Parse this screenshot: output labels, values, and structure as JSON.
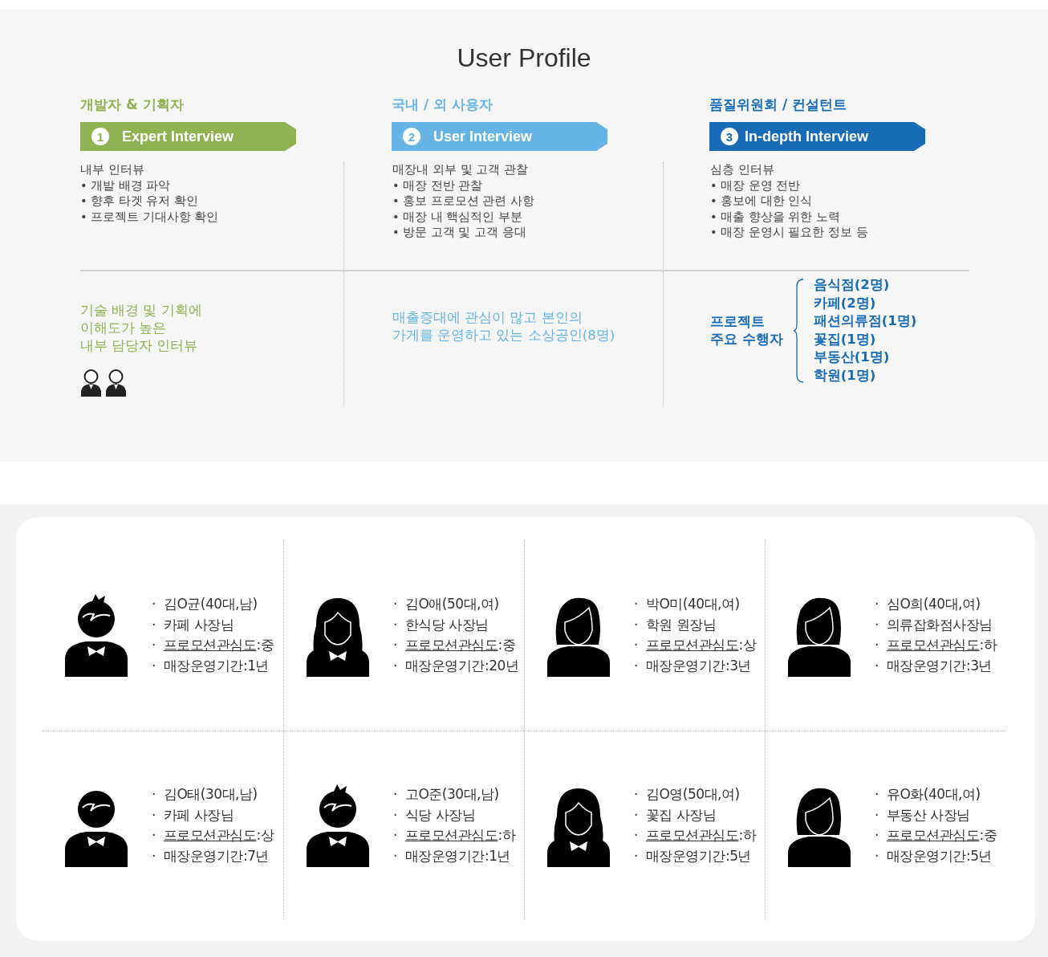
{
  "title": "User Profile",
  "groups": [
    {
      "kind": "people",
      "heading": "개발자 & 기획자",
      "color": "#8fb253",
      "badge": "1",
      "banner": "Expert Interview",
      "lead": "내부 인터뷰",
      "items": [
        "• 개발 배경 파악",
        "• 향후 타겟 유저 확인",
        "• 프로젝트 기대사항 확인"
      ],
      "summary": [
        "기술 배경 및 기획에",
        "이해도가 높은",
        "내부 담당자 인터뷰"
      ]
    },
    {
      "kind": "text",
      "heading": "국내 / 외 사용자",
      "color": "#66b4e6",
      "badge": "2",
      "banner": "User Interview",
      "lead": "매장내 외부 및 고객 관찰",
      "items": [
        "• 매장 전반 관찰",
        "• 홍보 프로모션  관련 사항",
        "• 매장 내 핵심적인 부분",
        "• 방문 고객 및 고객 응대"
      ],
      "summary": [
        "매출증대에 관심이 많고 본인의",
        "가게를 운영하고 있는 소상공인(8명)"
      ]
    },
    {
      "kind": "breakdown",
      "heading": "품질위원회 / 컨설턴트",
      "color": "#176bb7",
      "badge": "3",
      "banner": "In-depth Interview",
      "lead": "심층 인터뷰",
      "items": [
        "• 매장 운영 전반",
        "• 홍보에 대한 인식",
        "• 매출 향상을 위한 노력",
        "• 매장 운영시 필요한 정보 등"
      ],
      "summary": [
        "프로젝트",
        "주요 수행자"
      ],
      "breakdown": [
        "음식점(2명)",
        "카페(2명)",
        "패션의류점(1명)",
        "꽃집(1명)",
        "부동산(1명)",
        "학원(1명)"
      ]
    }
  ],
  "personas": [
    {
      "kind": "spiky-man",
      "lines": [
        "김O균(40대,남)",
        "카페 사장님",
        "프로모션관심도:중",
        "매장운영기간:1년"
      ]
    },
    {
      "kind": "long-hair-woman",
      "lines": [
        "김O애(50대,여)",
        "한식당 사장님",
        "프로모션관심도:중",
        "매장운영기간:20년"
      ]
    },
    {
      "kind": "woman",
      "lines": [
        "박O미(40대,여)",
        "학원 원장님",
        "프로모션관심도:상",
        "매장운영기간:3년"
      ]
    },
    {
      "kind": "woman",
      "lines": [
        "심O희(40대,여)",
        "의류잡화점사장님",
        "프로모션관심도:하",
        "매장운영기간:3년"
      ]
    },
    {
      "kind": "man",
      "lines": [
        "김O태(30대,남)",
        "카페 사장님",
        "프로모션관심도:상",
        "매장운영기간:7년"
      ]
    },
    {
      "kind": "spiky-man",
      "lines": [
        "고O준(30대,남)",
        "식당 사장님",
        "프로모션관심도:하",
        "매장운영기간:1년"
      ]
    },
    {
      "kind": "long-hair-woman",
      "lines": [
        "김O영(50대,여)",
        "꽃집 사장님",
        "프로모션관심도:하",
        "매장운영기간:5년"
      ]
    },
    {
      "kind": "woman",
      "lines": [
        "유O화(40대,여)",
        "부동산 사장님",
        "프로모션관심도:중",
        "매장운영기간:5년"
      ]
    }
  ],
  "bullet": "·"
}
